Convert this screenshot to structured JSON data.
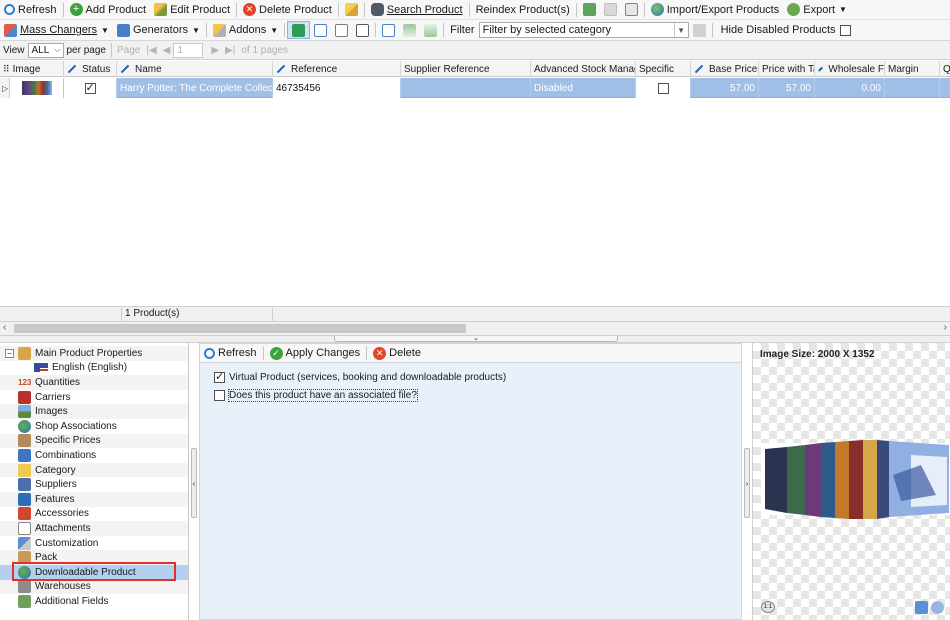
{
  "toolbar1": {
    "refresh": "Refresh",
    "add_product": "Add Product",
    "edit_product": "Edit Product",
    "delete_product": "Delete Product",
    "search_product": "Search Product",
    "reindex": "Reindex Product(s)",
    "import_export": "Import/Export Products",
    "export": "Export"
  },
  "toolbar2": {
    "mass_changers": "Mass Changers",
    "generators": "Generators",
    "addons": "Addons",
    "filter_label": "Filter",
    "filter_value": "Filter by selected category",
    "hide_disabled": "Hide Disabled Products"
  },
  "toolbar3": {
    "view_label": "View",
    "view_value": "ALL",
    "per_page": "per page",
    "page_label": "Page",
    "page_value": "1",
    "of_pages": "of 1 pages"
  },
  "grid": {
    "headers": {
      "image": "Image",
      "status": "Status",
      "name": "Name",
      "reference": "Reference",
      "supplier_reference": "Supplier Reference",
      "advanced_stock": "Advanced Stock Manage",
      "specific": "Specific",
      "base_price": "Base Price",
      "price_with_tax": "Price with Ta",
      "wholesale": "Wholesale F",
      "margin": "Margin",
      "q": "Q"
    },
    "row": {
      "name": "Harry Potter: The Complete Collection",
      "reference": "46735456",
      "advanced_stock": "Disabled",
      "base_price": "57.00",
      "price_with_tax": "57.00",
      "wholesale": "0.00"
    },
    "count": "1 Product(s)"
  },
  "tree": {
    "items": [
      "Main Product Properties",
      "English (English)",
      "Quantities",
      "Carriers",
      "Images",
      "Shop Associations",
      "Specific Prices",
      "Combinations",
      "Category",
      "Suppliers",
      "Features",
      "Accessories",
      "Attachments",
      "Customization",
      "Pack",
      "Downloadable Product",
      "Warehouses",
      "Additional Fields"
    ],
    "quantities_badge": "123",
    "selected": "Downloadable Product"
  },
  "detail": {
    "refresh": "Refresh",
    "apply": "Apply Changes",
    "delete": "Delete",
    "virtual_label": "Virtual Product (services, booking and downloadable products)",
    "virtual_checked": true,
    "file_label": "Does this product have an associated file?",
    "file_checked": false
  },
  "image_panel": {
    "size_text": "Image Size: 2000 X 1352",
    "zoom_badge": "1:1"
  },
  "colors": {
    "selection": "#9fbfe6",
    "highlight_border": "#e0302a",
    "accent_blue": "#1f5fb5"
  }
}
